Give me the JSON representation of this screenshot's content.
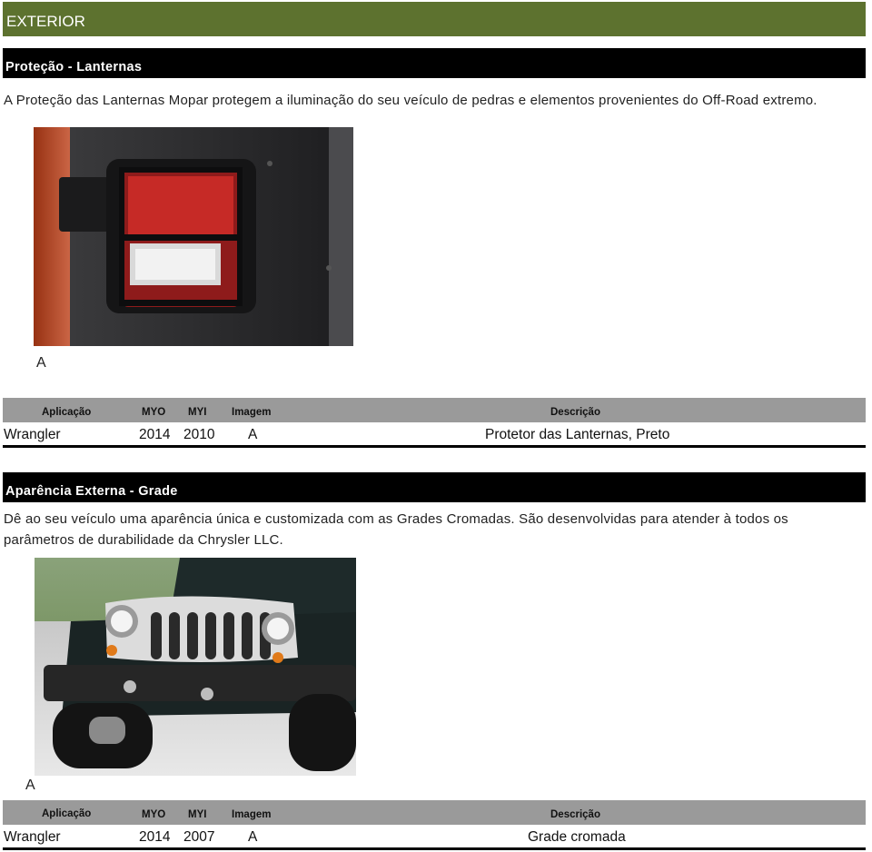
{
  "header": {
    "title": "EXTERIOR"
  },
  "sections": [
    {
      "title": "Proteção - Lanternas",
      "description": "A Proteção das Lanternas Mopar protegem a iluminação do seu veículo de pedras e elementos provenientes do Off-Road extremo.",
      "image_label": "A",
      "columns": {
        "application": "Aplicação",
        "myo": "MYO",
        "myi": "MYI",
        "image": "Imagem",
        "description": "Descrição"
      },
      "row": {
        "application": "Wrangler",
        "myo": "2014",
        "myi": "2010",
        "image": "A",
        "description": "Protetor das Lanternas, Preto"
      }
    },
    {
      "title": "Aparência Externa - Grade",
      "description": "Dê ao seu veículo uma aparência única e customizada com as Grades Cromadas. São desenvolvidas para atender à todos os parâmetros de durabilidade da Chrysler LLC.",
      "image_label": "A",
      "columns": {
        "application": "Aplicação",
        "myo": "MYO",
        "myi": "MYI",
        "image": "Imagem",
        "description": "Descrição"
      },
      "row": {
        "application": "Wrangler",
        "myo": "2014",
        "myi": "2007",
        "image": "A",
        "description": "Grade cromada"
      }
    }
  ],
  "colors": {
    "header_green": "#5d722f",
    "section_black": "#000000",
    "table_header_gray": "#9a9a9a"
  }
}
